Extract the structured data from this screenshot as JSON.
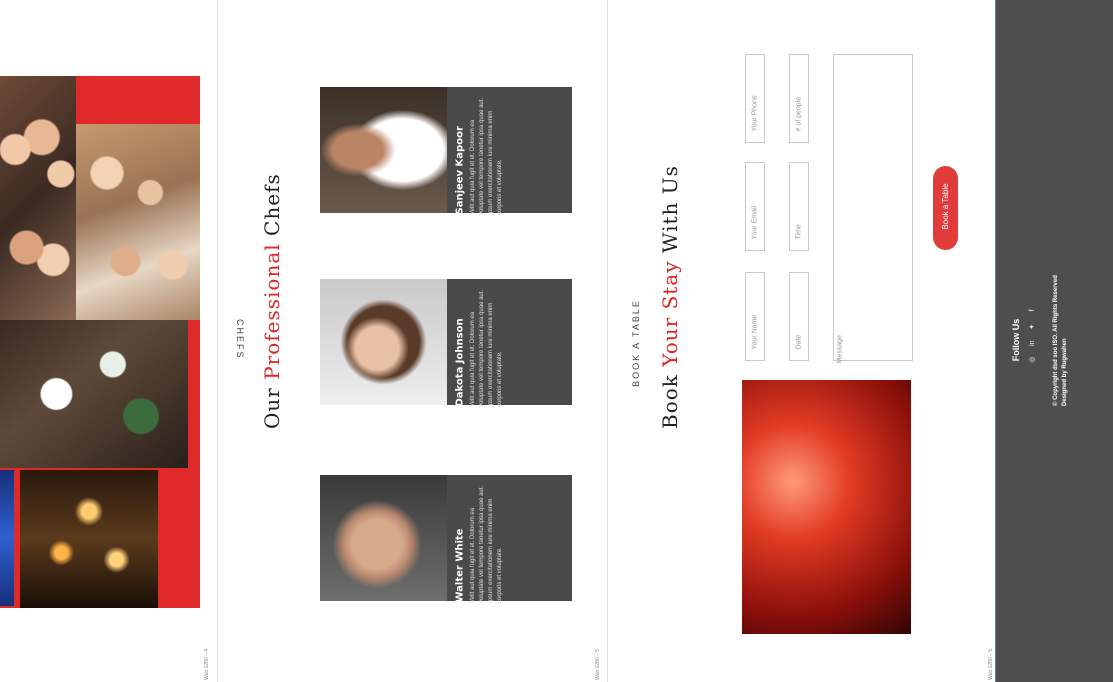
{
  "frames": {
    "gallery_label": "Web 1280 – 4",
    "chefs_label": "Web 1280 – 5",
    "book_label": "Web 1280 – 5",
    "footer_label": "Web 1280 – 5"
  },
  "chefs_section": {
    "kicker": "CHEFS",
    "title_prefix": "Our",
    "title_accent": "Professional",
    "title_suffix": "Chefs",
    "cards": [
      {
        "name": "Walter White",
        "bio": "Velit aut quia fugit et et. Dolorum ea voluptate vel tempore tenetur ipsa quae aut. Ipsum exercitationem iure minima enim corporis et voluptate."
      },
      {
        "name": "Dakota Johnson",
        "bio": "Velit aut quia fugit et et. Dolorum ea voluptate vel tempore tenetur ipsa quae aut. Ipsum exercitationem iure minima enim corporis et voluptate."
      },
      {
        "name": "Sanjeev Kapoor",
        "bio": "Velit aut quia fugit et et. Dolorum ea voluptate vel tempore tenetur ipsa quae aut. Ipsum exercitationem iure minima enim corporis et voluptate."
      }
    ]
  },
  "booking": {
    "kicker": "BOOK A TABLE",
    "title_prefix": "Book",
    "title_accent": "Your Stay",
    "title_suffix": "With Us",
    "fields": {
      "name": "Your Name",
      "email": "Your Email",
      "phone": "Your Phone",
      "date": "Date",
      "time": "Time",
      "people": "# of people",
      "message": "Message"
    },
    "button": "Book a Table"
  },
  "footer": {
    "follow": "Follow Us",
    "icons": [
      "instagram-icon",
      "linkedin-icon",
      "twitter-icon",
      "facebook-icon"
    ],
    "copyright": "© Copyright dsd soo ISO. All Rights Reserved",
    "designed_by": "Designed by Rugwahen"
  },
  "colors": {
    "accent": "#e32222",
    "card": "#4a4a4a",
    "footer": "#4e4e4e"
  }
}
